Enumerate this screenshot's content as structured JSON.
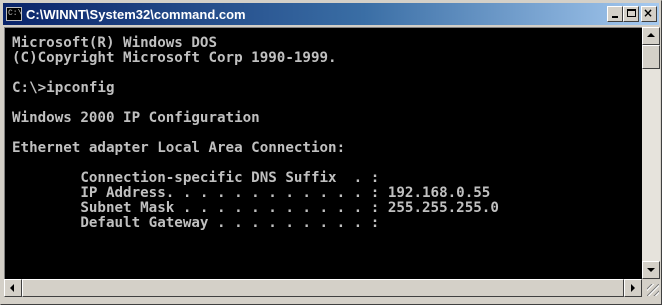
{
  "window": {
    "title": "C:\\WINNT\\System32\\command.com",
    "icon": "command-prompt-icon"
  },
  "caption_buttons": {
    "minimize": "minimize-icon",
    "maximize": "maximize-icon",
    "close": "close-icon",
    "close_glyph": "×"
  },
  "console": {
    "lines": [
      "Microsoft(R) Windows DOS",
      "(C)Copyright Microsoft Corp 1990-1999.",
      "",
      "C:\\>ipconfig",
      "",
      "Windows 2000 IP Configuration",
      "",
      "Ethernet adapter Local Area Connection:",
      "",
      "        Connection-specific DNS Suffix  . :",
      "        IP Address. . . . . . . . . . . . : 192.168.0.55",
      "        Subnet Mask . . . . . . . . . . . : 255.255.255.0",
      "        Default Gateway . . . . . . . . . :"
    ],
    "text_color": "#c0c0c0",
    "background_color": "#000000"
  },
  "scrollbars": {
    "up_arrow": "up-arrow-icon",
    "down_arrow": "down-arrow-icon",
    "left_arrow": "left-arrow-icon",
    "right_arrow": "right-arrow-icon"
  }
}
